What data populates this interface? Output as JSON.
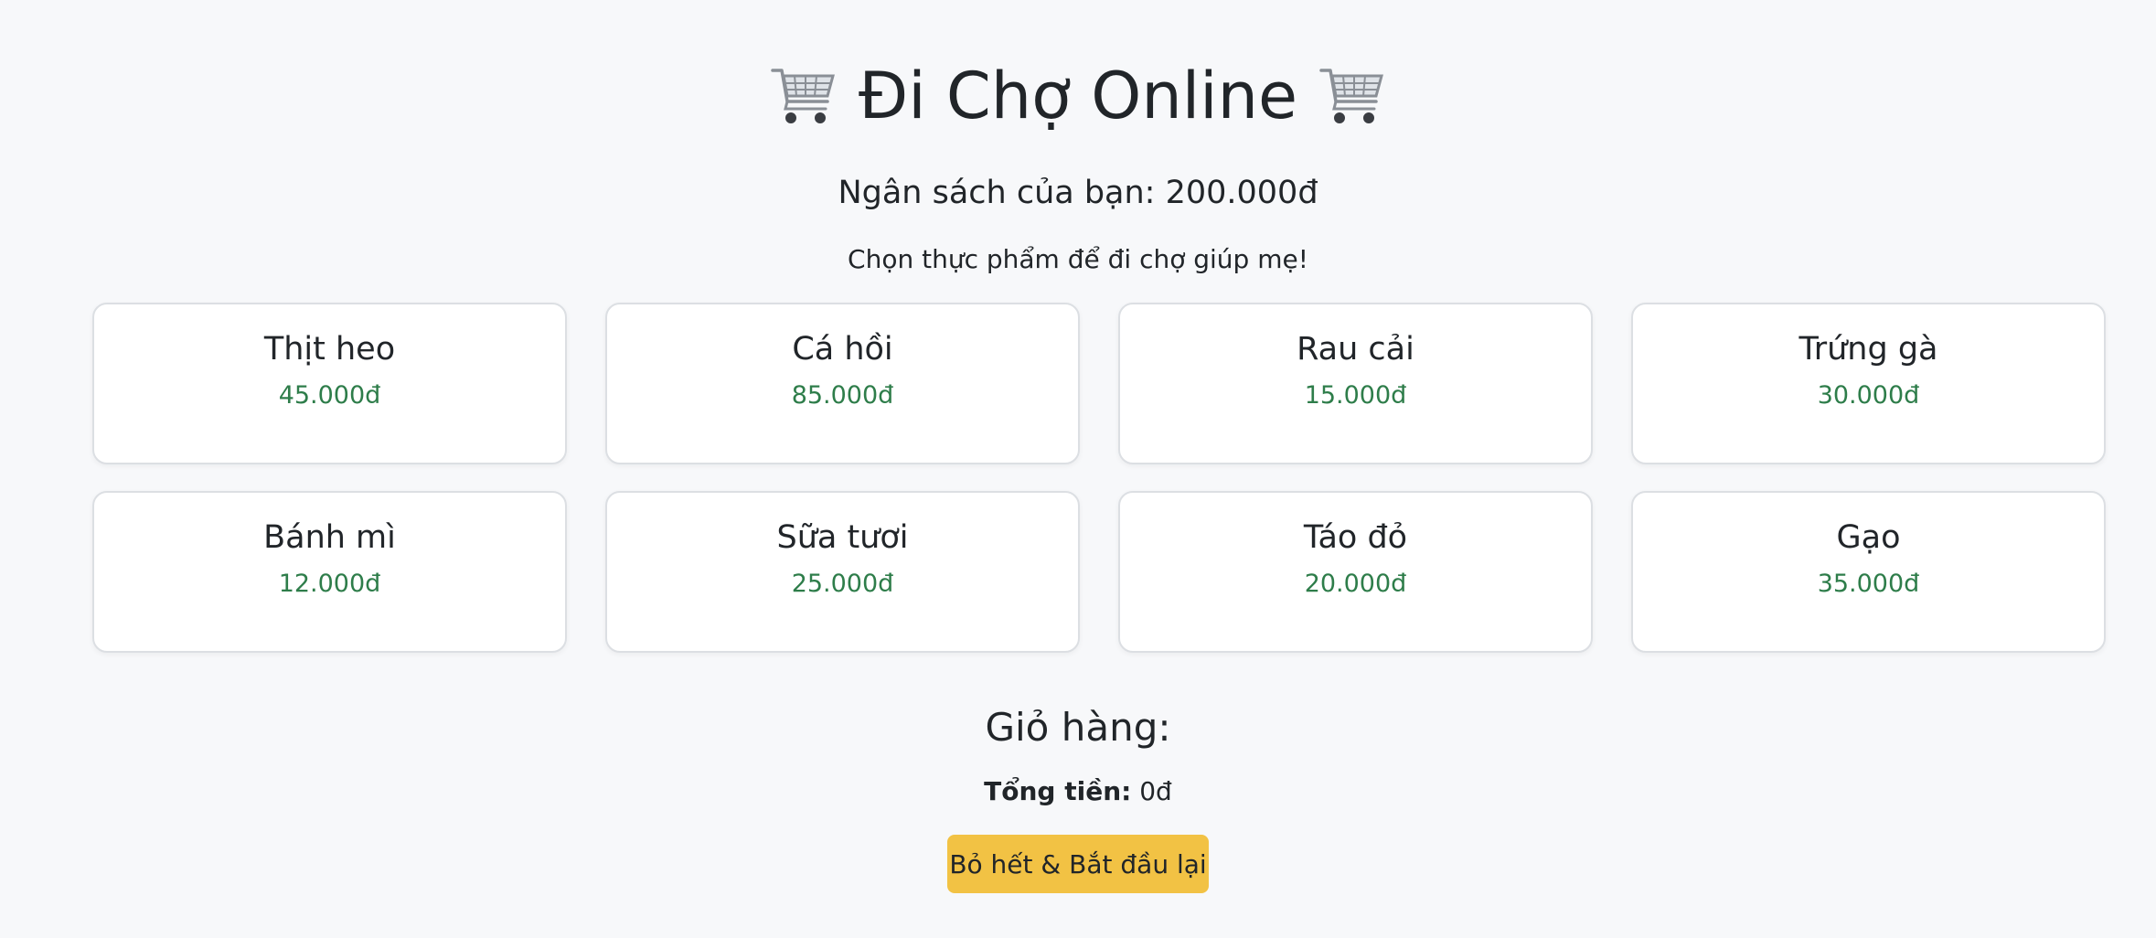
{
  "header": {
    "title": "Đi Chợ Online",
    "left_icon": "shopping-cart-icon",
    "right_icon": "shopping-cart-icon"
  },
  "budget_text": "Ngân sách của bạn: 200.000đ",
  "subtitle": "Chọn thực phẩm để đi chợ giúp mẹ!",
  "products": [
    {
      "name": "Thịt heo",
      "price": "45.000đ"
    },
    {
      "name": "Cá hồi",
      "price": "85.000đ"
    },
    {
      "name": "Rau cải",
      "price": "15.000đ"
    },
    {
      "name": "Trứng gà",
      "price": "30.000đ"
    },
    {
      "name": "Bánh mì",
      "price": "12.000đ"
    },
    {
      "name": "Sữa tươi",
      "price": "25.000đ"
    },
    {
      "name": "Táo đỏ",
      "price": "20.000đ"
    },
    {
      "name": "Gạo",
      "price": "35.000đ"
    }
  ],
  "cart": {
    "heading": "Giỏ hàng:",
    "total_label": "Tổng tiền:",
    "total_value": "0đ",
    "reset_label": "Bỏ hết & Bắt đầu lại"
  },
  "colors": {
    "background": "#f7f8fa",
    "price_green": "#2e7d4a",
    "reset_button": "#f2c244"
  }
}
